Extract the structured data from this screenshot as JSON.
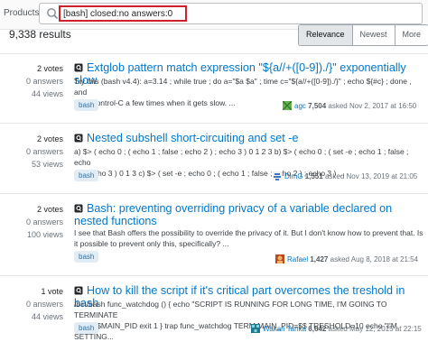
{
  "header": {
    "products_label": "Products",
    "search_value": "[bash] closed:no answers:0"
  },
  "results_count": "9,338 results",
  "tabs": [
    "Relevance",
    "Newest",
    "More ▾"
  ],
  "questions": [
    {
      "votes": "2 votes",
      "answers": "0 answers",
      "views": "44 views",
      "title": "Extglob pattern match expression \"${a//+([0-9])./}\" exponentially slow",
      "excerpt": [
        "Try this (bash v4.4): a=3.14 ; while true ; do a=\"$a $a\" ; time c=\"${a//+([0-9])./}\" ; echo ${#c} ; done , and",
        "type Control-C a few times when it gets slow. ..."
      ],
      "tag": "bash",
      "user": "agc",
      "rep": "7,504",
      "asked": "asked Nov 2, 2017 at 16:50"
    },
    {
      "votes": "2 votes",
      "answers": "0 answers",
      "views": "53 views",
      "title": "Nested subshell short-circuiting and set -e",
      "excerpt": [
        "a) $> ( echo 0 ; ( echo 1 ; false ; echo 2 ) ; echo 3 ) 0 1 2 3 b) $> ( echo 0 ; ( set -e ; echo 1 ; false ; echo",
        "2 ) ; echo 3 ) 0 1 3 c) $> ( set -e ; echo 0 ; ( echo 1 ; false ; echo 2 ) ; echo 3 ) ..."
      ],
      "tag": "bash",
      "user": "DimG",
      "rep": "1,551",
      "asked": "asked Nov 13, 2019 at 21:05"
    },
    {
      "votes": "2 votes",
      "answers": "0 answers",
      "views": "100 views",
      "title": "Bash: preventing overriding privacy of a variable declared on nested functions",
      "excerpt": [
        "I see that Bash offers the possibility to override the privacy of it. But I don't know how to prevent that. Is",
        "it possible to prevent only this, specifically? ..."
      ],
      "tag": "bash",
      "user": "Rafael",
      "rep": "1,427",
      "asked": "asked Aug 8, 2018 at 21:54"
    },
    {
      "votes": "1 vote",
      "answers": "0 answers",
      "views": "44 views",
      "title": "How to kill the script if it's critical part overcomes the treshold in bash",
      "excerpt": [
        "/bin/bash func_watchdog () { echo \"SCRIPT IS RUNNING FOR LONG TIME, I'M GOING TO TERMINATE",
        "IT\" kill $MAIN_PID exit 1 } trap func_watchdog TERM MAIN_PID=$$ TRESHOLD=10 echo \"I'M SETTING..."
      ],
      "tag": "bash",
      "user": "Wakan Tanka",
      "rep": "6,642",
      "asked": "asked May 12, 2015 at 22:15"
    }
  ]
}
